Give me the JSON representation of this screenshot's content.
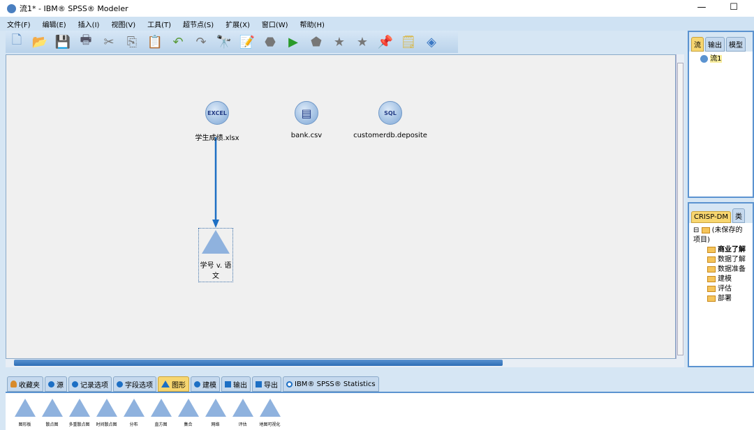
{
  "window": {
    "title": "流1* - IBM® SPSS® Modeler",
    "minimize": "—",
    "maximize": "☐"
  },
  "menu": [
    "文件(F)",
    "编辑(E)",
    "插入(I)",
    "视图(V)",
    "工具(T)",
    "超节点(S)",
    "扩展(X)",
    "窗口(W)",
    "帮助(H)"
  ],
  "toolbar": [
    {
      "name": "new-icon",
      "g": "🗋"
    },
    {
      "name": "open-icon",
      "g": "📂"
    },
    {
      "name": "save-icon",
      "g": "💾"
    },
    {
      "name": "print-icon",
      "g": "🖶"
    },
    {
      "name": "cut-icon",
      "g": "✂"
    },
    {
      "name": "copy-icon",
      "g": "⎘"
    },
    {
      "name": "paste-icon",
      "g": "📋"
    },
    {
      "name": "undo-icon",
      "g": "↶"
    },
    {
      "name": "redo-icon",
      "g": "↷"
    },
    {
      "name": "find-icon",
      "g": "🔭"
    },
    {
      "name": "edit-icon",
      "g": "📝"
    },
    {
      "name": "stop-icon",
      "g": "⬣"
    },
    {
      "name": "run-icon",
      "g": "▶"
    },
    {
      "name": "run-selection-icon",
      "g": "⬟"
    },
    {
      "name": "star-icon",
      "g": "★"
    },
    {
      "name": "star-2-icon",
      "g": "★"
    },
    {
      "name": "pin-icon",
      "g": "📌"
    },
    {
      "name": "annotation-icon",
      "g": "🗒"
    },
    {
      "name": "modeler-icon",
      "g": "◈"
    }
  ],
  "canvas": {
    "nodes": [
      {
        "label": "学生成绩.xlsx",
        "icon": "EXCEL"
      },
      {
        "label": "bank.csv",
        "icon": "▤"
      },
      {
        "label": "customerdb.deposite",
        "icon": "SQL"
      },
      {
        "label": "学号 v. 语文",
        "icon": "plot"
      }
    ]
  },
  "right_top": {
    "tabs": [
      "流",
      "输出",
      "模型"
    ],
    "active": 0,
    "tree": [
      "流1"
    ]
  },
  "right_bottom": {
    "tabs": [
      "CRISP-DM",
      "类"
    ],
    "active": 0,
    "root": "(未保存的项目)",
    "items": [
      "商业了解",
      "数据了解",
      "数据准备",
      "建模",
      "评估",
      "部署"
    ]
  },
  "palette": {
    "tabs": [
      "收藏夹",
      "源",
      "记录选项",
      "字段选项",
      "图形",
      "建模",
      "输出",
      "导出",
      "IBM® SPSS® Statistics"
    ],
    "active": 4,
    "items": [
      "图形板",
      "散点图",
      "多重散点图",
      "时间散点图",
      "分布",
      "直方图",
      "集合",
      "网络",
      "评估",
      "地图可视化"
    ]
  },
  "colors": {
    "accent": "#1d6fc4",
    "active_tab": "#f7d670"
  }
}
